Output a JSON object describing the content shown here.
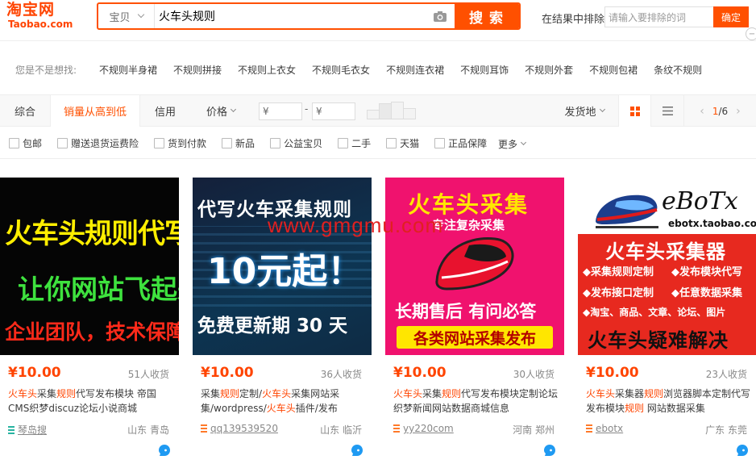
{
  "logo": {
    "cn": "淘宝网",
    "en": "Taobao.com"
  },
  "search": {
    "scope": "宝贝",
    "query": "火车头规则",
    "button": "搜索",
    "exclude_label": "在结果中排除",
    "exclude_placeholder": "请输入要排除的词",
    "exclude_button": "确定"
  },
  "suggest": {
    "label": "您是不是想找:",
    "items": [
      "不规则半身裙",
      "不规则拼接",
      "不规则上衣女",
      "不规则毛衣女",
      "不规则连衣裙",
      "不规则耳饰",
      "不规则外套",
      "不规则包裙",
      "条纹不规则"
    ]
  },
  "sort": {
    "tabs": [
      "综合",
      "销量从高到低",
      "信用",
      "价格"
    ],
    "price_from_placeholder": "¥",
    "price_to_placeholder": "¥",
    "price_dash": "-",
    "ship_from": "发货地",
    "page_current": "1",
    "page_total": "/6",
    "prev": "‹",
    "next": "›"
  },
  "filters": {
    "items": [
      "包邮",
      "赠送退货运费险",
      "货到付款",
      "新品",
      "公益宝贝",
      "二手",
      "天猫",
      "正品保障"
    ],
    "more": "更多"
  },
  "watermark": "www.gmgmu.com",
  "products": [
    {
      "price": "¥10.00",
      "sold": "51人收货",
      "title_parts": [
        [
          "火车头",
          true
        ],
        [
          "采集",
          false
        ],
        [
          "规则",
          true
        ],
        [
          "代写发布模块 帝国CMS织梦discuz论坛小说商城",
          false
        ]
      ],
      "shop": "琴岛搜",
      "location": "山东 青岛",
      "image": {
        "line1": "火车头规则代写",
        "line2": "让你网站飞起来",
        "line3": "企业团队，技术保障"
      }
    },
    {
      "price": "¥10.00",
      "sold": "36人收货",
      "title_parts": [
        [
          "采集",
          false
        ],
        [
          "规则",
          true
        ],
        [
          "定制/",
          false
        ],
        [
          "火车头",
          true
        ],
        [
          "采集网站采集/wordpress/",
          false
        ],
        [
          "火车头",
          true
        ],
        [
          "插件/发布",
          false
        ]
      ],
      "shop": "qq139539520",
      "location": "山东 临沂",
      "image": {
        "line1": "代写火车采集规则",
        "line2": "10元起！",
        "line3": "免费更新期 30 天"
      }
    },
    {
      "price": "¥10.00",
      "sold": "30人收货",
      "title_parts": [
        [
          "火车头",
          true
        ],
        [
          "采集",
          false
        ],
        [
          "规则",
          true
        ],
        [
          "代写发布模块定制论坛织梦新闻网站数据商城信息",
          false
        ]
      ],
      "shop": "yy220com",
      "location": "河南 郑州",
      "image": {
        "line1": "火车头采集",
        "line2": "专注复杂采集",
        "line3": "长期售后 有问必答",
        "line4": "各类网站采集发布"
      }
    },
    {
      "price": "¥10.00",
      "sold": "23人收货",
      "title_parts": [
        [
          "火车头",
          true
        ],
        [
          "采集器",
          false
        ],
        [
          "规则",
          true
        ],
        [
          "浏览器脚本定制代写发布模块",
          false
        ],
        [
          "规则",
          true
        ],
        [
          " 网站数据采集",
          false
        ]
      ],
      "shop": "ebotx",
      "location": "广东 东莞",
      "image": {
        "brand": "eBoTx",
        "url": "ebotx.taobao.com",
        "headline": "火车头采集器",
        "features": [
          "采集规则定制",
          "发布模块代写",
          "发布接口定制",
          "任意数据采集",
          "淘宝、商品、文章、论坛、图片"
        ],
        "footer": "火车头疑难解决"
      }
    }
  ],
  "colors": {
    "accent": "#ff5000",
    "price": "#ff4400"
  }
}
